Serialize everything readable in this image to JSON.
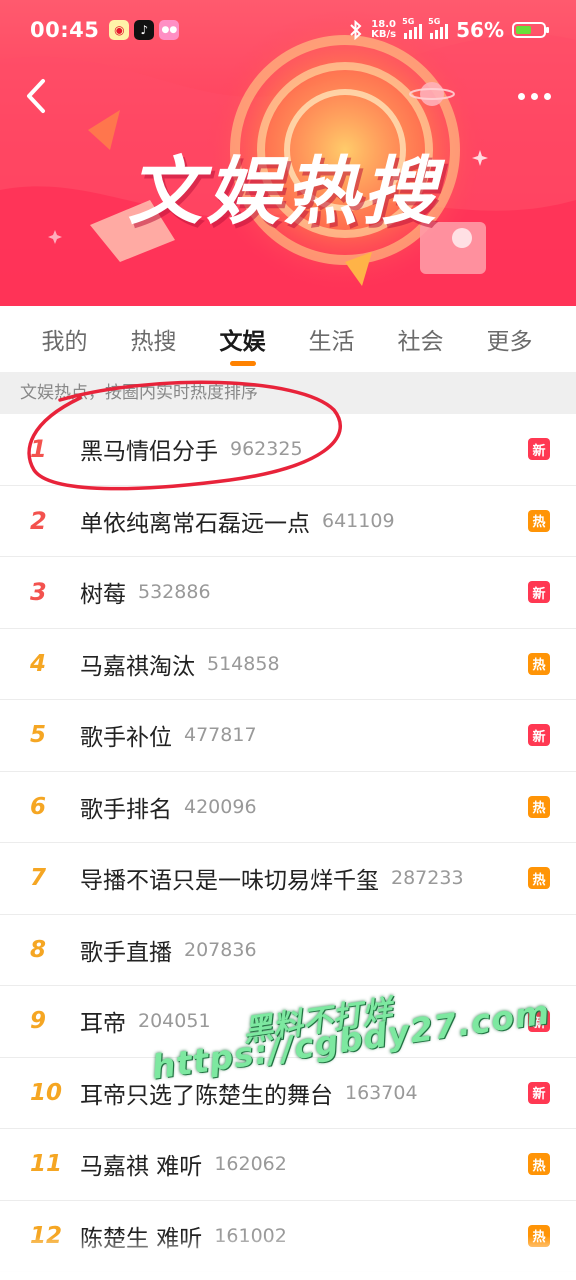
{
  "status_bar": {
    "time": "00:45",
    "speed_value": "18.0",
    "speed_unit": "KB/s",
    "signal_1": "5G",
    "signal_2": "5G",
    "battery": "56%",
    "battery_level": 0.56
  },
  "banner": {
    "title": "文娱热搜"
  },
  "tabs": [
    {
      "label": "我的"
    },
    {
      "label": "热搜"
    },
    {
      "label": "文娱",
      "active": true
    },
    {
      "label": "生活"
    },
    {
      "label": "社会"
    },
    {
      "label": "更多"
    }
  ],
  "subtitle": "文娱热点，按圈内实时热度排序",
  "items": [
    {
      "rank": "1",
      "title": "黑马情侣分手",
      "count": "962325",
      "badge": "新"
    },
    {
      "rank": "2",
      "title": "单依纯离常石磊远一点",
      "count": "641109",
      "badge": "热"
    },
    {
      "rank": "3",
      "title": "树莓",
      "count": "532886",
      "badge": "新"
    },
    {
      "rank": "4",
      "title": "马嘉祺淘汰",
      "count": "514858",
      "badge": "热"
    },
    {
      "rank": "5",
      "title": "歌手补位",
      "count": "477817",
      "badge": "新"
    },
    {
      "rank": "6",
      "title": "歌手排名",
      "count": "420096",
      "badge": "热"
    },
    {
      "rank": "7",
      "title": "导播不语只是一味切易烊千玺",
      "count": "287233",
      "badge": "热"
    },
    {
      "rank": "8",
      "title": "歌手直播",
      "count": "207836",
      "badge": ""
    },
    {
      "rank": "9",
      "title": "耳帝",
      "count": "204051",
      "badge": "新"
    },
    {
      "rank": "10",
      "title": "耳帝只选了陈楚生的舞台",
      "count": "163704",
      "badge": "新"
    },
    {
      "rank": "11",
      "title": "马嘉祺 难听",
      "count": "162062",
      "badge": "热"
    },
    {
      "rank": "12",
      "title": "陈楚生 难听",
      "count": "161002",
      "badge": "热"
    }
  ],
  "watermark": {
    "line1": "黑料不打烊",
    "line2": "https://cgbdy27.com"
  },
  "colors": {
    "banner": "#ff3f5c",
    "tab_indicator": "#ff8200",
    "rank_top": "#f3524e",
    "rank_other": "#f5a623",
    "badge_new": "#ff3852",
    "badge_hot": "#ff9406",
    "annotation_circle": "#e8233a",
    "watermark": "#7de8a0"
  }
}
